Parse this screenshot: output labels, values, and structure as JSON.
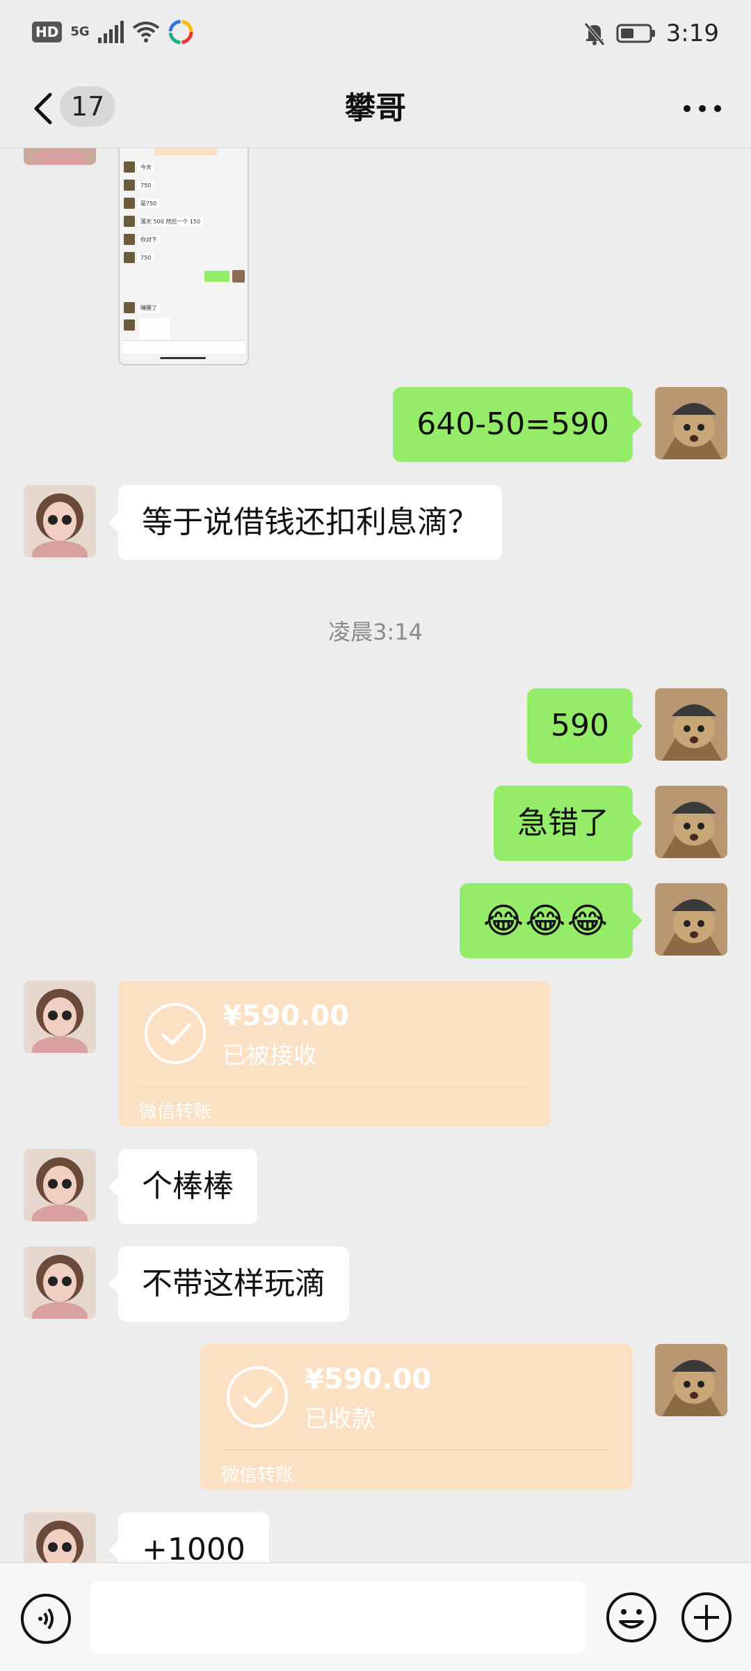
{
  "status_bar": {
    "hd": "HD",
    "network": "5G",
    "time": "3:19"
  },
  "header": {
    "unread_count": "17",
    "title": "攀哥"
  },
  "shared_screenshot": {
    "rows": [
      "今天",
      "750",
      "是750",
      "落天 500 然后一个 150",
      "你对下",
      "750",
      "睡醒了"
    ]
  },
  "messages": {
    "m1": "640-50=590",
    "m2": "等于说借钱还扣利息滴？",
    "timestamp": "凌晨3:14",
    "m3": "590",
    "m4": "急错了",
    "m5": "😂😂😂",
    "m6": "个棒棒",
    "m7": "不带这样玩滴",
    "m8": "+1000"
  },
  "transfer_received": {
    "amount": "¥590.00",
    "status": "已被接收",
    "brand": "微信转账"
  },
  "transfer_sent": {
    "amount": "¥590.00",
    "status": "已收款",
    "brand": "微信转账"
  },
  "colors": {
    "outgoing_bubble": "#95ec69",
    "incoming_bubble": "#ffffff",
    "transfer_card": "#fbe0c4",
    "background": "#ededed"
  }
}
